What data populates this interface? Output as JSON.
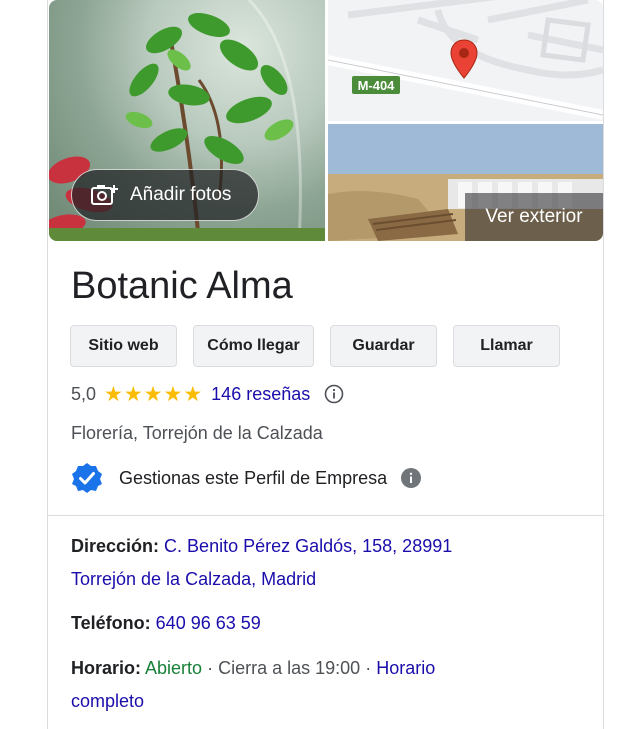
{
  "photos": {
    "add_photos_label": "Añadir fotos",
    "exterior_label": "Ver exterior",
    "map_road_label": "M-404"
  },
  "business": {
    "name": "Botanic Alma",
    "actions": [
      "Sitio web",
      "Cómo llegar",
      "Guardar",
      "Llamar"
    ],
    "rating": "5,0",
    "stars": "★★★★★",
    "reviews": "146 reseñas",
    "category": "Florería, Torrejón de la Calzada",
    "manage_text": "Gestionas este Perfil de Empresa"
  },
  "details": {
    "address_label": "Dirección:",
    "address_line1": "C. Benito Pérez Galdós, 158, 28991",
    "address_line2": "Torrejón de la Calzada, Madrid",
    "phone_label": "Teléfono:",
    "phone": "640 96 63 59",
    "hours_label": "Horario:",
    "hours_status": "Abierto",
    "hours_separator": "·",
    "hours_close": "Cierra a las 19:00",
    "hours_full_1": "Horario",
    "hours_full_2": "completo"
  },
  "colors": {
    "link": "#1a0dab",
    "open": "#188038",
    "star": "#fbbc04",
    "verified": "#1a73e8",
    "pin": "#ea4335"
  }
}
